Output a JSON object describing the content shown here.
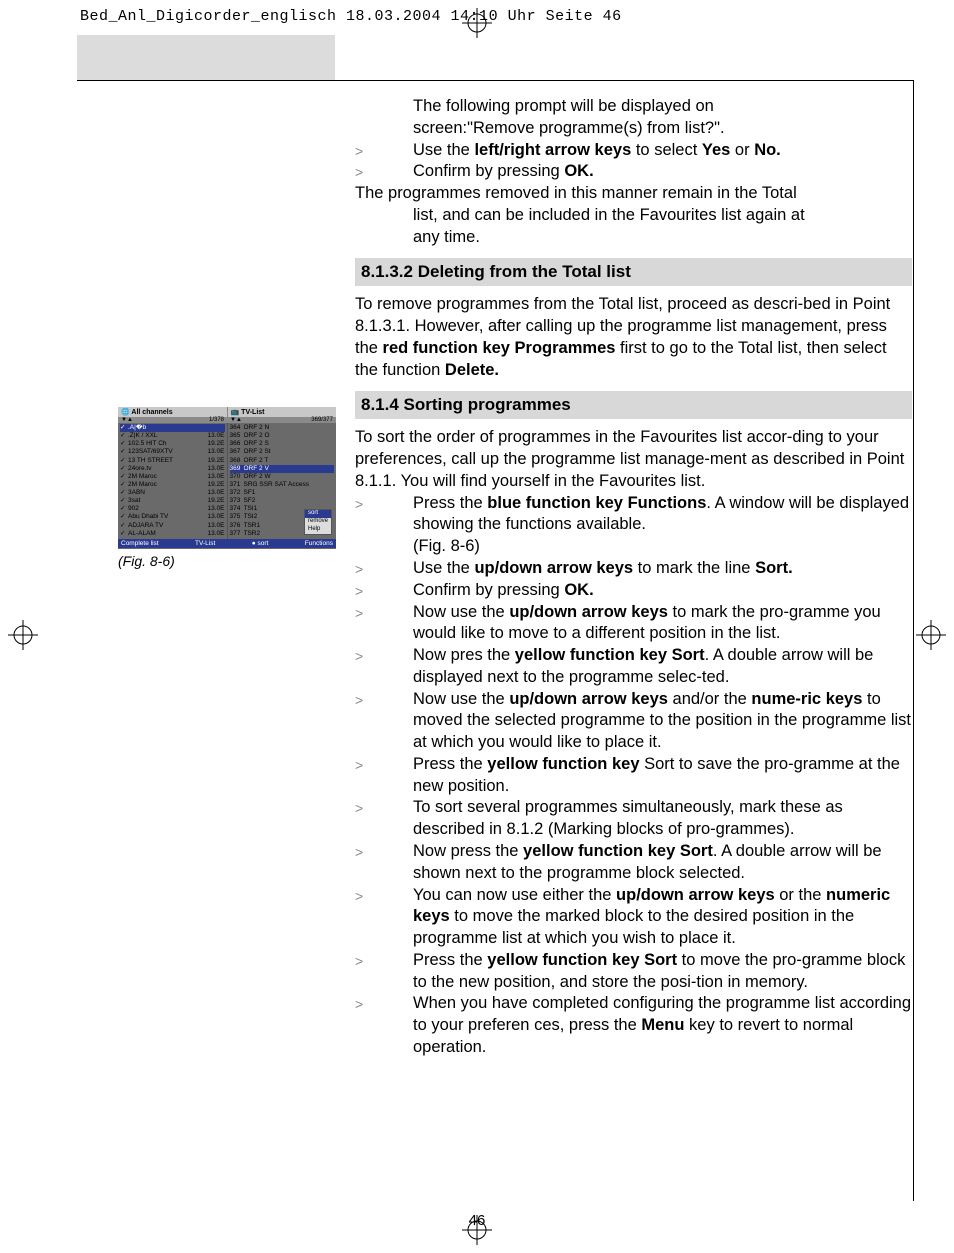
{
  "header": "Bed_Anl_Digicorder_englisch  18.03.2004  14:10 Uhr  Seite 46",
  "page_number": "46",
  "intro": {
    "line1a": "The following prompt will be displayed on",
    "line1b": "screen:\"Remove programme(s) from list?\"."
  },
  "steps_top": [
    {
      "pre": "Use the ",
      "b1": "left/right arrow keys",
      "mid": " to select ",
      "b2": "Yes",
      "mid2": " or ",
      "b3": "No."
    },
    {
      "pre": "Confirm by pressing ",
      "b1": "OK."
    }
  ],
  "after_top": {
    "hang": "The programmes removed in this manner remain in the Total",
    "l2": "list, and can be included in the Favourites list again at",
    "l3": "any time."
  },
  "h8132": "8.1.3.2 Deleting from the Total list",
  "p8132": {
    "t1": "To remove programmes from the Total list, proceed as descri-bed in Point 8.1.3.1. However, after calling up the programme list management, press the ",
    "b1": "red function key Programmes",
    "t2": " first to go to the Total list, then select the function ",
    "b2": "Delete."
  },
  "h814": "8.1.4 Sorting programmes",
  "p814_intro": "To sort the order of programmes in the Favourites list accor-ding to your preferences, call up the programme list manage-ment as described in Point 8.1.1. You will find yourself in the Favourites list.",
  "steps814": [
    {
      "pre": "Press the ",
      "b1": "blue function key Functions",
      "post": ". A window will be displayed showing the functions available.",
      "extra": "(Fig. 8-6)"
    },
    {
      "pre": "Use the ",
      "b1": "up/down arrow keys",
      "post": " to mark the line ",
      "b2": "Sort."
    },
    {
      "pre": "Confirm by pressing ",
      "b1": "OK."
    },
    {
      "pre": "Now use the ",
      "b1": "up/down arrow keys",
      "post": " to mark the pro-gramme you would like to move to a different position in the list."
    },
    {
      "pre": "Now pres the ",
      "b1": "yellow function key Sort",
      "post": ". A double arrow will be displayed next to the programme selec-ted."
    },
    {
      "pre": "Now use the ",
      "b1": "up/down arrow keys",
      "post": " and/or the ",
      "b2": "nume-ric keys",
      "post2": " to moved the selected programme to the position in the programme list at which you would like to place it."
    },
    {
      "pre": "Press the ",
      "b1": "yellow function key",
      "post": " Sort to save the pro-gramme at the new position."
    },
    {
      "pre": "To sort several programmes simultaneously, mark these as described in 8.1.2 (Marking blocks of pro-grammes)."
    },
    {
      "pre": "Now press the ",
      "b1": "yellow function key Sort",
      "post": ". A double arrow will be shown next to the programme block selected."
    },
    {
      "pre": "You can now use either the ",
      "b1": "up/down arrow keys",
      "post": " or the ",
      "b2": "numeric keys",
      "post2": " to move the marked block to the desired position in the programme list at which you wish to place it."
    },
    {
      "pre": "Press the ",
      "b1": "yellow function key Sort",
      "post": " to move the pro-gramme block to the new position, and store the posi-tion in memory."
    },
    {
      "pre": "When you have completed configuring the programme list according to your preferen ces, press the ",
      "b1": "Menu",
      "post": " key to revert to normal operation."
    }
  ],
  "figure": {
    "caption": "(Fig. 8-6)",
    "top_left": "All channels",
    "top_right": "TV-List",
    "sub_left_count": "1/378",
    "sub_right_count": "369/377",
    "left_rows": [
      {
        "name": ".A|�b",
        "freq": ""
      },
      {
        "name": ".Z|K / XXL",
        "freq": "13.0E"
      },
      {
        "name": "102.5 HIT Ch",
        "freq": "19.2E"
      },
      {
        "name": "123SAT/69XTV",
        "freq": "13.0E"
      },
      {
        "name": "13 TH STREET",
        "freq": "19.2E"
      },
      {
        "name": "24ore.tv",
        "freq": "13.0E"
      },
      {
        "name": "2M Maroc",
        "freq": "13.0E"
      },
      {
        "name": "2M Maroc",
        "freq": "19.2E"
      },
      {
        "name": "3ABN",
        "freq": "13.0E"
      },
      {
        "name": "3sat",
        "freq": "19.2E"
      },
      {
        "name": "902",
        "freq": "13.0E"
      },
      {
        "name": "Abu Dhabi TV",
        "freq": "13.0E"
      },
      {
        "name": "ADJARA TV",
        "freq": "13.0E"
      },
      {
        "name": "AL-ALAM",
        "freq": "13.0E"
      }
    ],
    "right_rows": [
      {
        "nr": "364",
        "name": "ORF 2 N"
      },
      {
        "nr": "365",
        "name": "ORF 2 O"
      },
      {
        "nr": "366",
        "name": "ORF 2 S"
      },
      {
        "nr": "367",
        "name": "ORF 2 St"
      },
      {
        "nr": "368",
        "name": "ORF 2 T"
      },
      {
        "nr": "369",
        "name": "ORF 2 V",
        "hi": true
      },
      {
        "nr": "370",
        "name": "ORF 2 W"
      },
      {
        "nr": "371",
        "name": "SRG SSR SAT Access"
      },
      {
        "nr": "372",
        "name": "SF1"
      },
      {
        "nr": "373",
        "name": "SF2"
      },
      {
        "nr": "374",
        "name": "TSI1"
      },
      {
        "nr": "375",
        "name": "TSI2"
      },
      {
        "nr": "376",
        "name": "TSR1"
      },
      {
        "nr": "377",
        "name": "TSR2"
      }
    ],
    "popup": [
      "sort",
      "remove",
      "Help"
    ],
    "bottom": {
      "a": "Complete list",
      "b": "TV-List",
      "c": "● sort",
      "d": "Functions"
    }
  }
}
